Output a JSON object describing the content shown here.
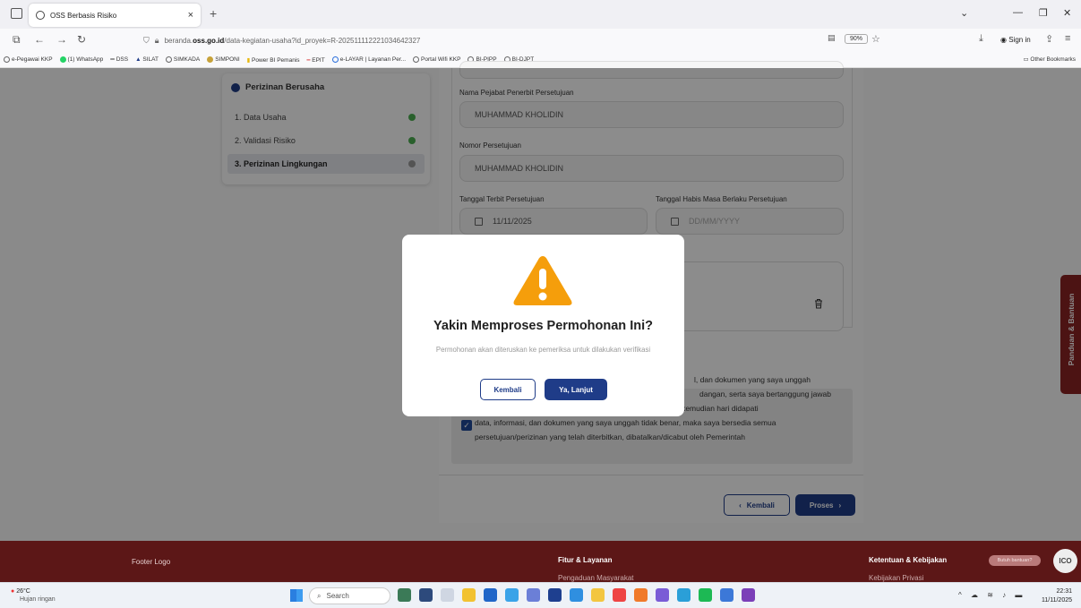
{
  "browser": {
    "tab_title": "OSS Berbasis Risiko",
    "url_prefix": "beranda.",
    "url_domain": "oss.go.id",
    "url_rest": "/data-kegiatan-usaha?id_proyek=R-202511112221034642327",
    "zoom": "90%",
    "sign_in": "Sign in",
    "bookmarks": [
      "e-Pegawai KKP",
      "(1) WhatsApp",
      "DSS",
      "SILAT",
      "SIMKADA",
      "SIMPONI",
      "Power BI Pemanis",
      "EPIT",
      "e-LAYAR | Layanan Per...",
      "Portal Wifi KKP",
      "BI-PIPP",
      "BI-DJPT"
    ],
    "other_bookmarks": "Other Bookmarks"
  },
  "sidebar": {
    "title": "Perizinan Berusaha",
    "items": [
      {
        "label": "1. Data Usaha",
        "status": "done"
      },
      {
        "label": "2. Validasi Risiko",
        "status": "done"
      },
      {
        "label": "3. Perizinan Lingkungan",
        "status": "pending"
      }
    ]
  },
  "form": {
    "pejabat_label": "Nama Pejabat Penerbit Persetujuan",
    "pejabat_value": "MUHAMMAD KHOLIDIN",
    "nomor_label": "Nomor Persetujuan",
    "nomor_value": "MUHAMMAD KHOLIDIN",
    "terbit_label": "Tanggal Terbit Persetujuan",
    "terbit_value": "11/11/2025",
    "habis_label": "Tanggal Habis Masa Berlaku Persetujuan",
    "habis_placeholder": "DD/MM/YYYY",
    "decl_line1": "l, dan dokumen yang saya unggah",
    "decl_line2": "dangan, serta saya bertanggung jawab",
    "decl_line3": "penuh atas data, informasi dan dokumen tersebut. Apabila di kemudian hari didapati",
    "decl_line4": "data, informasi, dan dokumen yang saya unggah tidak benar, maka saya bersedia semua",
    "decl_line5": "persetujuan/perizinan yang telah diterbitkan, dibatalkan/dicabut oleh Pemerintah",
    "back_label": "Kembali",
    "proses_label": "Proses"
  },
  "panduan": "Panduan & Bantuan",
  "modal": {
    "title": "Yakin Memproses Permohonan Ini?",
    "description": "Permohonan akan diteruskan ke pemeriksa untuk dilakukan verifikasi",
    "back_label": "Kembali",
    "ok_label": "Ya, Lanjut"
  },
  "footer": {
    "logo": "Footer Logo",
    "col2_title": "Fitur & Layanan",
    "col2_item": "Pengaduan Masyarakat",
    "col3_title": "Ketentuan & Kebijakan",
    "col3_item": "Kebijakan Privasi",
    "pill": "Butuh bantuan?",
    "ico": "ICO"
  },
  "taskbar": {
    "temp": "26°C",
    "weather": "Hujan ringan",
    "search": "Search",
    "time": "22:31",
    "date": "11/11/2025"
  }
}
